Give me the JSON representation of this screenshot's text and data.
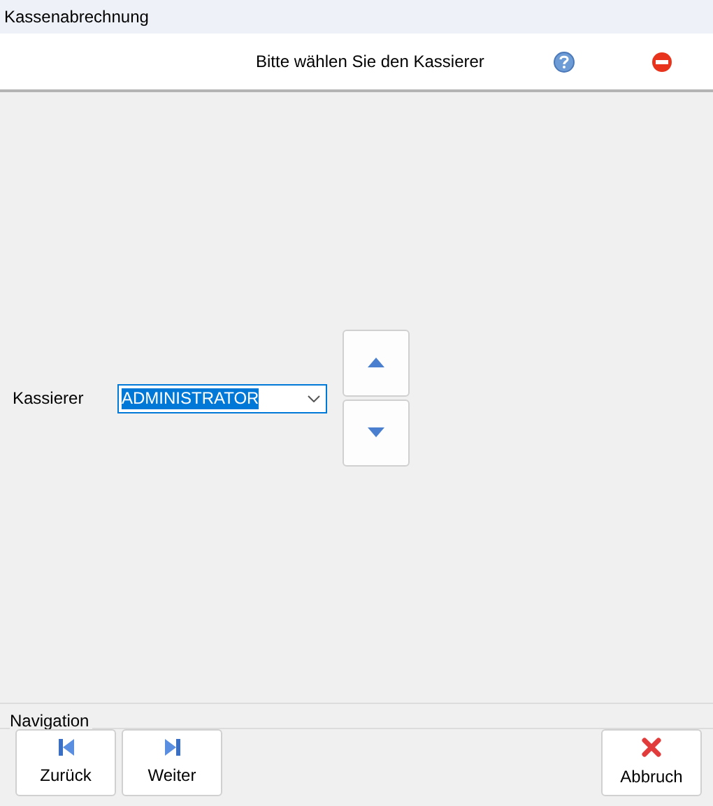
{
  "window": {
    "title": "Kassenabrechnung"
  },
  "header": {
    "prompt": "Bitte wählen Sie den Kassierer"
  },
  "cashier": {
    "label": "Kassierer",
    "value": "ADMINISTRATOR",
    "text_selected": true
  },
  "navigation": {
    "title": "Navigation",
    "buttons": [
      {
        "kind": "back",
        "label": "Zurück"
      },
      {
        "kind": "next",
        "label": "Weiter"
      },
      {
        "kind": "cancel",
        "label": "Abbruch"
      }
    ]
  }
}
